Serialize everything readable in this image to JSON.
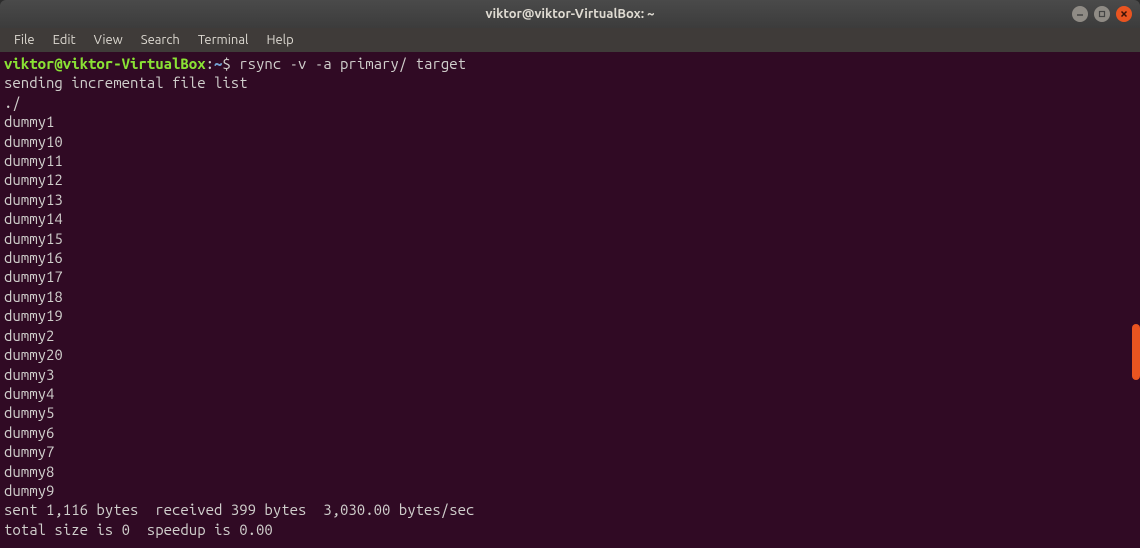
{
  "window": {
    "title": "viktor@viktor-VirtualBox: ~"
  },
  "menubar": {
    "items": [
      "File",
      "Edit",
      "View",
      "Search",
      "Terminal",
      "Help"
    ]
  },
  "prompt": {
    "userhost": "viktor@viktor-VirtualBox",
    "colon": ":",
    "path": "~",
    "dollar": "$"
  },
  "command": " rsync -v -a primary/ target",
  "output": {
    "header": "sending incremental file list",
    "lines": [
      "./",
      "dummy1",
      "dummy10",
      "dummy11",
      "dummy12",
      "dummy13",
      "dummy14",
      "dummy15",
      "dummy16",
      "dummy17",
      "dummy18",
      "dummy19",
      "dummy2",
      "dummy20",
      "dummy3",
      "dummy4",
      "dummy5",
      "dummy6",
      "dummy7",
      "dummy8",
      "dummy9"
    ],
    "blank": "",
    "summary1": "sent 1,116 bytes  received 399 bytes  3,030.00 bytes/sec",
    "summary2": "total size is 0  speedup is 0.00"
  }
}
